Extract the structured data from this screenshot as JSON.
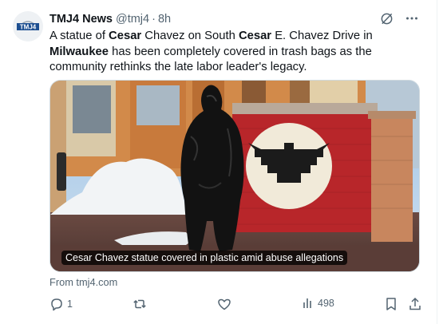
{
  "author": {
    "avatar_text": "TMJ4",
    "name": "TMJ4 News",
    "handle": "@tmj4",
    "separator": "·",
    "time": "8h"
  },
  "tweet": {
    "text_parts": [
      "A statue of ",
      "Cesar",
      " Chavez on South ",
      "Cesar",
      " E. Chavez Drive in ",
      "Milwaukee",
      " has been completely covered in trash bags as the community rethinks the late labor leader's legacy."
    ]
  },
  "media": {
    "caption": "Cesar Chavez statue covered in plastic amid abuse allegations"
  },
  "link": {
    "source": "From tmj4.com"
  },
  "actions": {
    "replies": "1",
    "reposts": "",
    "likes": "",
    "views": "498"
  },
  "colors": {
    "text": "#0f1419",
    "muted": "#536471",
    "brick_red": "#c92a2a",
    "logo_blue": "#1d4f91"
  },
  "icons": [
    "grok-icon",
    "more-icon",
    "reply-icon",
    "repost-icon",
    "like-icon",
    "views-icon",
    "bookmark-icon",
    "share-icon"
  ]
}
